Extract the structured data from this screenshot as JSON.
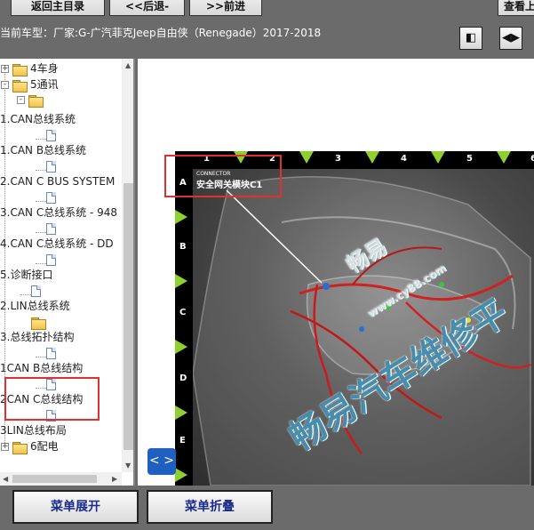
{
  "nav": {
    "buttons": [
      "返回主目录",
      "<<后退-",
      ">>前进",
      "查看上"
    ]
  },
  "info": {
    "vehicle_label": "当前车型：",
    "vehicle_value": "厂家:G-广汽菲克Jeep自由侠（Renegade）2017-2018"
  },
  "tree": {
    "items": [
      {
        "label": "4车身",
        "type": "folder",
        "expander": "+"
      },
      {
        "label": "5通讯",
        "type": "folder",
        "expander": "-"
      },
      {
        "label": "",
        "type": "folder",
        "expander": "-"
      },
      {
        "label": "1.CAN总线系统",
        "type": "text"
      },
      {
        "label": "",
        "type": "doc"
      },
      {
        "label": "1.CAN B总线系统",
        "type": "text"
      },
      {
        "label": "",
        "type": "doc"
      },
      {
        "label": "2.CAN C BUS SYSTEM",
        "type": "text"
      },
      {
        "label": "",
        "type": "doc"
      },
      {
        "label": "3.CAN C总线系统 - 948",
        "type": "text"
      },
      {
        "label": "",
        "type": "doc"
      },
      {
        "label": "4.CAN C总线系统 - DD",
        "type": "text"
      },
      {
        "label": "",
        "type": "doc"
      },
      {
        "label": "5.诊断接口",
        "type": "text"
      },
      {
        "label": "",
        "type": "doc"
      },
      {
        "label": "2.LIN总线系统",
        "type": "text"
      },
      {
        "label": "",
        "type": "folder"
      },
      {
        "label": "3.总线拓扑结构",
        "type": "text"
      },
      {
        "label": "",
        "type": "doc"
      },
      {
        "label": "1CAN B总线结构",
        "type": "text"
      },
      {
        "label": "",
        "type": "doc"
      },
      {
        "label": "2CAN C总线结构",
        "type": "text"
      },
      {
        "label": "",
        "type": "doc"
      },
      {
        "label": "3LIN总线布局",
        "type": "text"
      },
      {
        "label": "6配电",
        "type": "folder",
        "expander": "+"
      }
    ]
  },
  "diagram": {
    "columns": [
      "1",
      "2",
      "3",
      "4",
      "5",
      "6"
    ],
    "rows": [
      "A",
      "B",
      "C",
      "D",
      "E"
    ],
    "connector_caption": "CONNECTOR",
    "connector_name": "安全网关模块C1",
    "watermark_1": "畅易汽车维修平",
    "watermark_2": "畅易",
    "watermark_3": "www.cy88.com",
    "nav_arrows": "< >"
  },
  "bottom": {
    "expand_label": "菜单展开",
    "collapse_label": "菜单折叠"
  },
  "colors": {
    "accent_green": "#8dd030",
    "highlight_red": "#e03030",
    "nav_blue": "#1f5fc0"
  }
}
